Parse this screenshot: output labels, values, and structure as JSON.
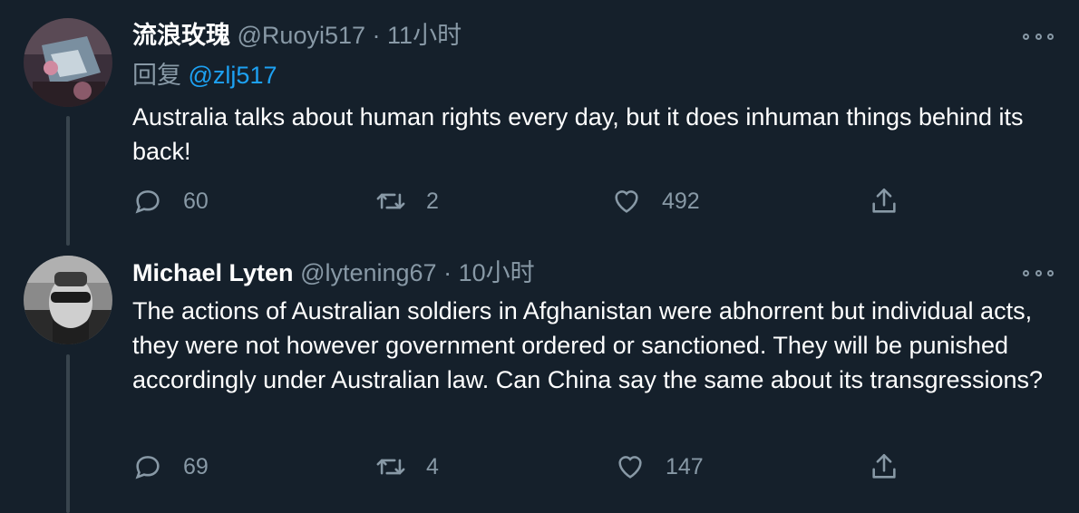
{
  "tweets": [
    {
      "display_name": "流浪玫瑰",
      "handle": "@Ruoyi517",
      "dot": "·",
      "time": "11小时",
      "reply_prefix": "回复",
      "reply_to": "@zlj517",
      "text": "Australia talks about human rights every day, but it does inhuman things behind its back!",
      "replies": "60",
      "retweets": "2",
      "likes": "492"
    },
    {
      "display_name": "Michael Lyten",
      "handle": "@lytening67",
      "dot": "·",
      "time": "10小时",
      "text": "The actions of Australian soldiers in Afghanistan were abhorrent but individual acts, they were not however government ordered or sanctioned. They will be punished accordingly under Australian law. Can China say the same about its transgressions?",
      "replies": "69",
      "retweets": "4",
      "likes": "147"
    }
  ],
  "colors": {
    "background": "#15202b",
    "muted": "#8899a6",
    "link": "#1da1f2",
    "divider": "#38444d"
  },
  "icons": [
    "reply-icon",
    "retweet-icon",
    "like-icon",
    "share-icon",
    "more-icon"
  ]
}
